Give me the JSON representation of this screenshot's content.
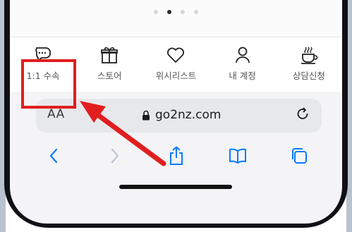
{
  "pager": {
    "dot_count": 4,
    "active_index": 1
  },
  "app_nav": {
    "items": [
      {
        "label": "1:1 수속",
        "icon": "chat-bubble-icon"
      },
      {
        "label": "스토어",
        "icon": "gift-icon"
      },
      {
        "label": "위시리스트",
        "icon": "heart-icon"
      },
      {
        "label": "내 계정",
        "icon": "person-icon"
      },
      {
        "label": "상담신청",
        "icon": "coffee-cup-icon"
      }
    ]
  },
  "safari": {
    "reader_label": "AA",
    "url": "go2nz.com"
  },
  "toolbar": {
    "buttons": [
      "back-icon",
      "forward-icon",
      "share-icon",
      "bookmarks-icon",
      "tabs-icon"
    ]
  },
  "colors": {
    "accent_blue": "#0a7aff",
    "highlight_red": "#e11e1e",
    "disabled": "#b9c6d6"
  }
}
